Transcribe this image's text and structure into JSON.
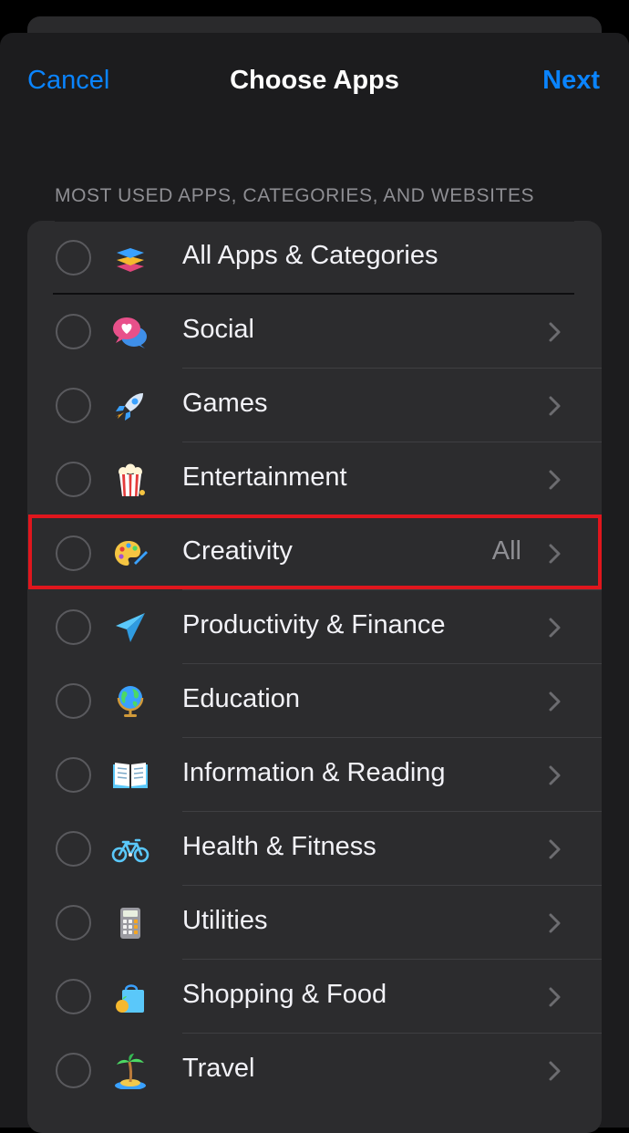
{
  "nav": {
    "cancel_label": "Cancel",
    "title": "Choose Apps",
    "next_label": "Next"
  },
  "section_header": "MOST USED APPS, CATEGORIES, AND WEBSITES",
  "colors": {
    "accent": "#0a84ff",
    "highlight_border": "#e0161d",
    "background": "#1c1c1e",
    "cell": "#2c2c2e"
  },
  "rows": [
    {
      "label": "All Apps & Categories",
      "icon": "stack-layers-icon",
      "detail": "",
      "chevron": false
    },
    {
      "label": "Social",
      "icon": "speech-bubble-heart-icon",
      "detail": "",
      "chevron": true
    },
    {
      "label": "Games",
      "icon": "rocket-icon",
      "detail": "",
      "chevron": true
    },
    {
      "label": "Entertainment",
      "icon": "popcorn-icon",
      "detail": "",
      "chevron": true
    },
    {
      "label": "Creativity",
      "icon": "palette-icon",
      "detail": "All",
      "chevron": true
    },
    {
      "label": "Productivity & Finance",
      "icon": "paper-plane-icon",
      "detail": "",
      "chevron": true
    },
    {
      "label": "Education",
      "icon": "globe-icon",
      "detail": "",
      "chevron": true
    },
    {
      "label": "Information & Reading",
      "icon": "open-book-icon",
      "detail": "",
      "chevron": true
    },
    {
      "label": "Health & Fitness",
      "icon": "bicycle-icon",
      "detail": "",
      "chevron": true
    },
    {
      "label": "Utilities",
      "icon": "calculator-icon",
      "detail": "",
      "chevron": true
    },
    {
      "label": "Shopping & Food",
      "icon": "shopping-bag-icon",
      "detail": "",
      "chevron": true
    },
    {
      "label": "Travel",
      "icon": "palm-island-icon",
      "detail": "",
      "chevron": true
    }
  ]
}
